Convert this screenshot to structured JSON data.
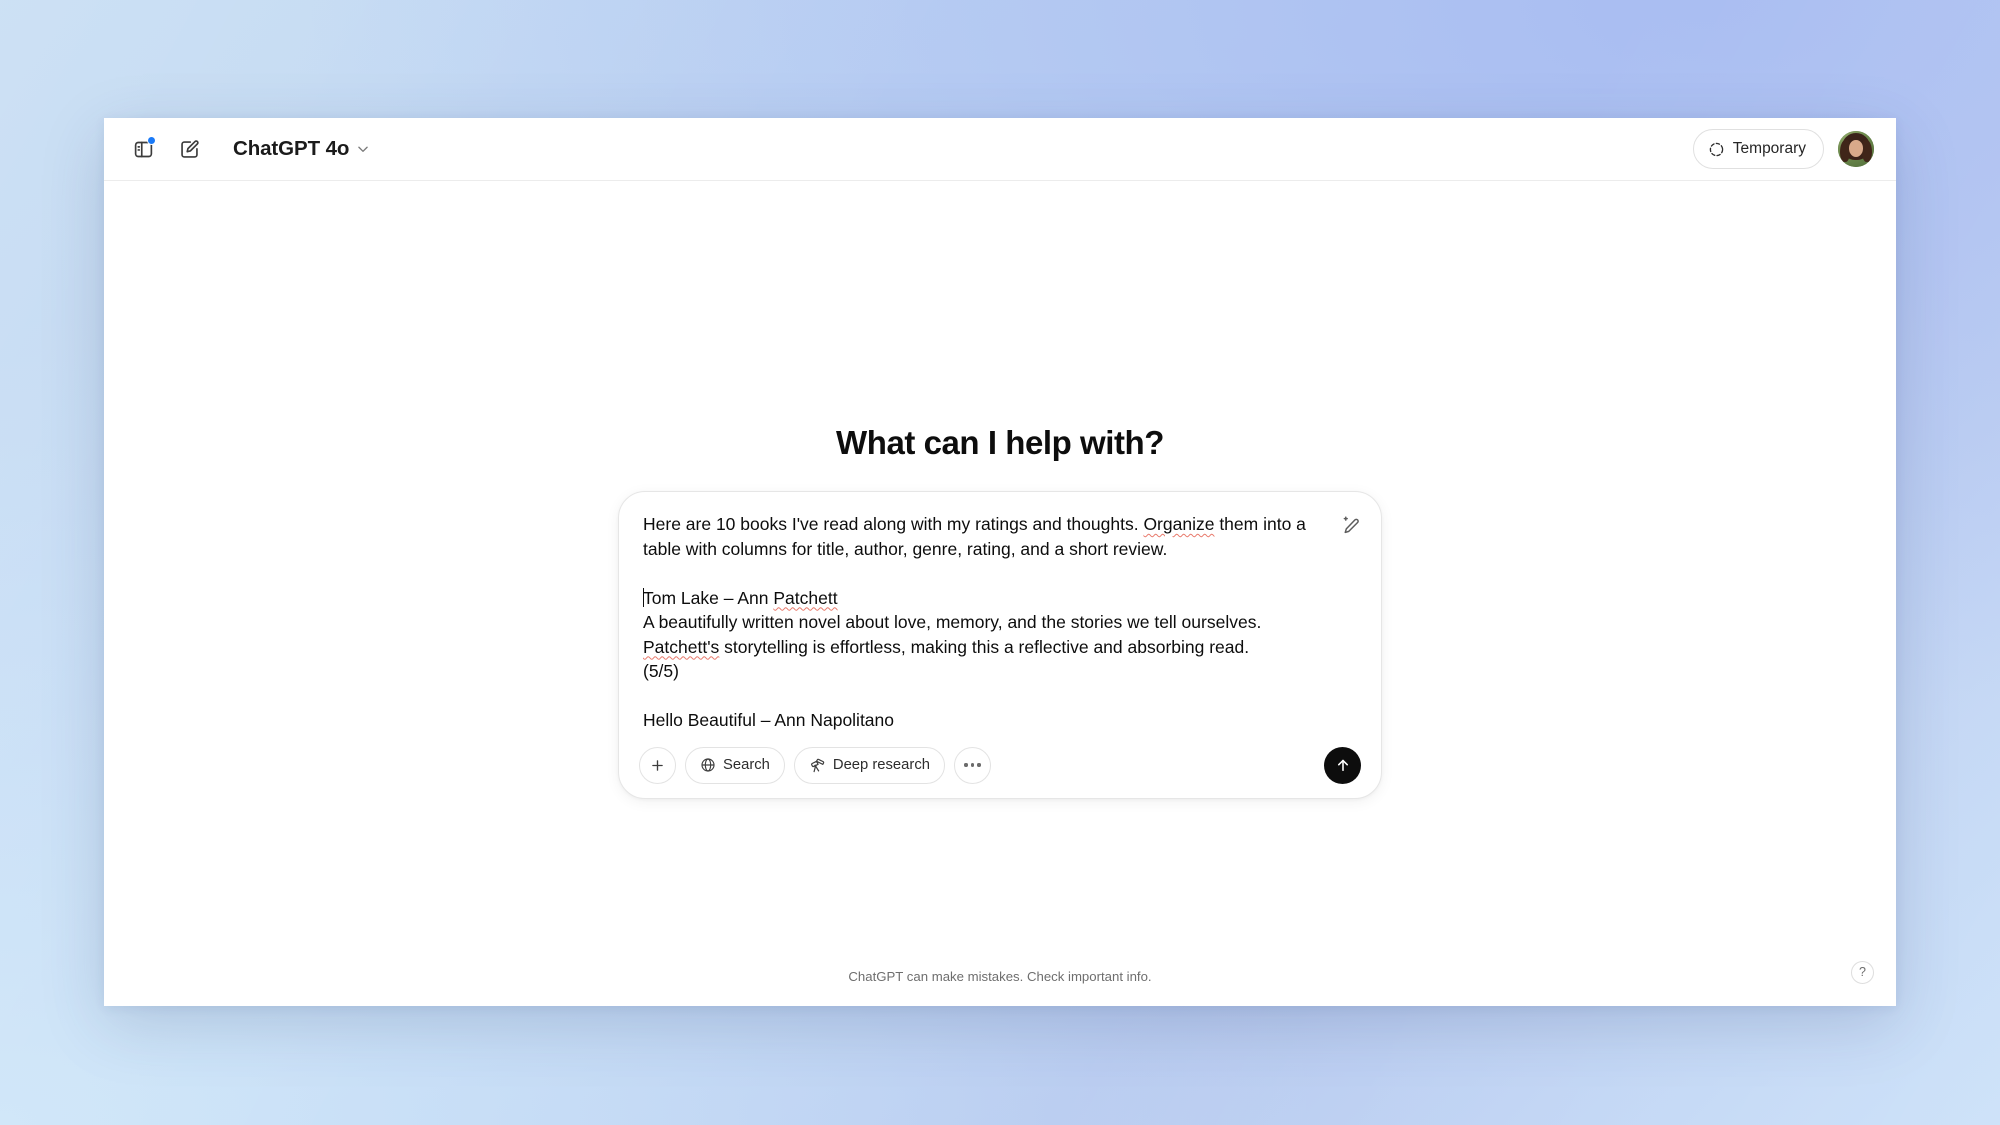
{
  "window": {
    "header": {
      "sidebar_toggle_icon": "sidebar-panel-icon",
      "new_chat_icon": "compose-pencil-icon",
      "model_name": "ChatGPT 4o",
      "model_chevron_icon": "chevron-down-icon",
      "temporary_label": "Temporary",
      "temporary_icon": "dashed-circle-icon",
      "avatar_label": "user-avatar"
    },
    "main": {
      "greeting": "What can I help with?",
      "composer": {
        "edit_icon": "sparkle-pencil-icon",
        "paragraphs": [
          {
            "id": "p1",
            "segments": [
              {
                "text": "Here are 10 books I've read along with my ratings and thoughts. ",
                "misspelled": false
              },
              {
                "text": "Organize",
                "misspelled": true
              },
              {
                "text": " them into a table with columns for title, author, genre, rating, and a short review.",
                "misspelled": false
              }
            ]
          },
          {
            "id": "p2",
            "segments": []
          },
          {
            "id": "p3",
            "caret": true,
            "segments": [
              {
                "text": "Tom Lake – Ann ",
                "misspelled": false
              },
              {
                "text": "Patchett",
                "misspelled": true
              }
            ]
          },
          {
            "id": "p4",
            "segments": [
              {
                "text": "A beautifully written novel about love, memory, and the stories we tell ourselves. ",
                "misspelled": false
              },
              {
                "text": "Patchett's",
                "misspelled": true
              },
              {
                "text": " storytelling is effortless, making this a reflective and absorbing read.",
                "misspelled": false
              }
            ]
          },
          {
            "id": "p5",
            "segments": [
              {
                "text": "(5/5)",
                "misspelled": false
              }
            ]
          },
          {
            "id": "p6",
            "segments": []
          },
          {
            "id": "p7",
            "segments": [
              {
                "text": "Hello Beautiful – Ann Napolitano",
                "misspelled": false
              }
            ]
          }
        ],
        "toolbar": {
          "attach_label": "+",
          "attach_icon": "plus-icon",
          "search_label": "Search",
          "search_icon": "globe-icon",
          "deep_research_label": "Deep research",
          "deep_research_icon": "telescope-icon",
          "more_icon": "ellipsis-icon",
          "send_icon": "arrow-up-icon"
        }
      }
    },
    "footer": {
      "disclaimer": "ChatGPT can make mistakes. Check important info.",
      "help_label": "?"
    }
  },
  "colors": {
    "accent_blue": "#1a7af8",
    "send_button": "#0d0d0d",
    "text_primary": "#0d0d0d",
    "text_muted": "#6e6e6e",
    "spellcheck_underline": "#e8796b",
    "window_background": "#ffffff"
  }
}
